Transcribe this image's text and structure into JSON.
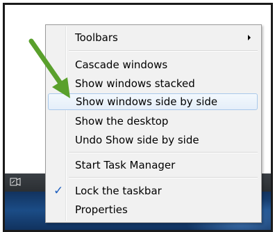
{
  "menu": {
    "items": [
      {
        "label": "Toolbars",
        "has_submenu": true
      },
      {
        "label": "Cascade windows"
      },
      {
        "label": "Show windows stacked"
      },
      {
        "label": "Show windows side by side",
        "highlighted": true
      },
      {
        "label": "Show the desktop"
      },
      {
        "label": "Undo Show side by side"
      },
      {
        "label": "Start Task Manager"
      },
      {
        "label": "Lock the taskbar",
        "checked": true
      },
      {
        "label": "Properties"
      }
    ]
  },
  "taskbar": {
    "icon": "show-desktop-icon"
  },
  "annotation": {
    "arrow_color": "#5aa02c",
    "points_to": "Show windows side by side"
  },
  "colors": {
    "menu_bg": "#f1f1f1",
    "highlight_border": "#a8c8ea",
    "check_color": "#1d5fbf",
    "taskbar_bg": "#2b2f33",
    "desktop_bg": "#1b4c86"
  }
}
